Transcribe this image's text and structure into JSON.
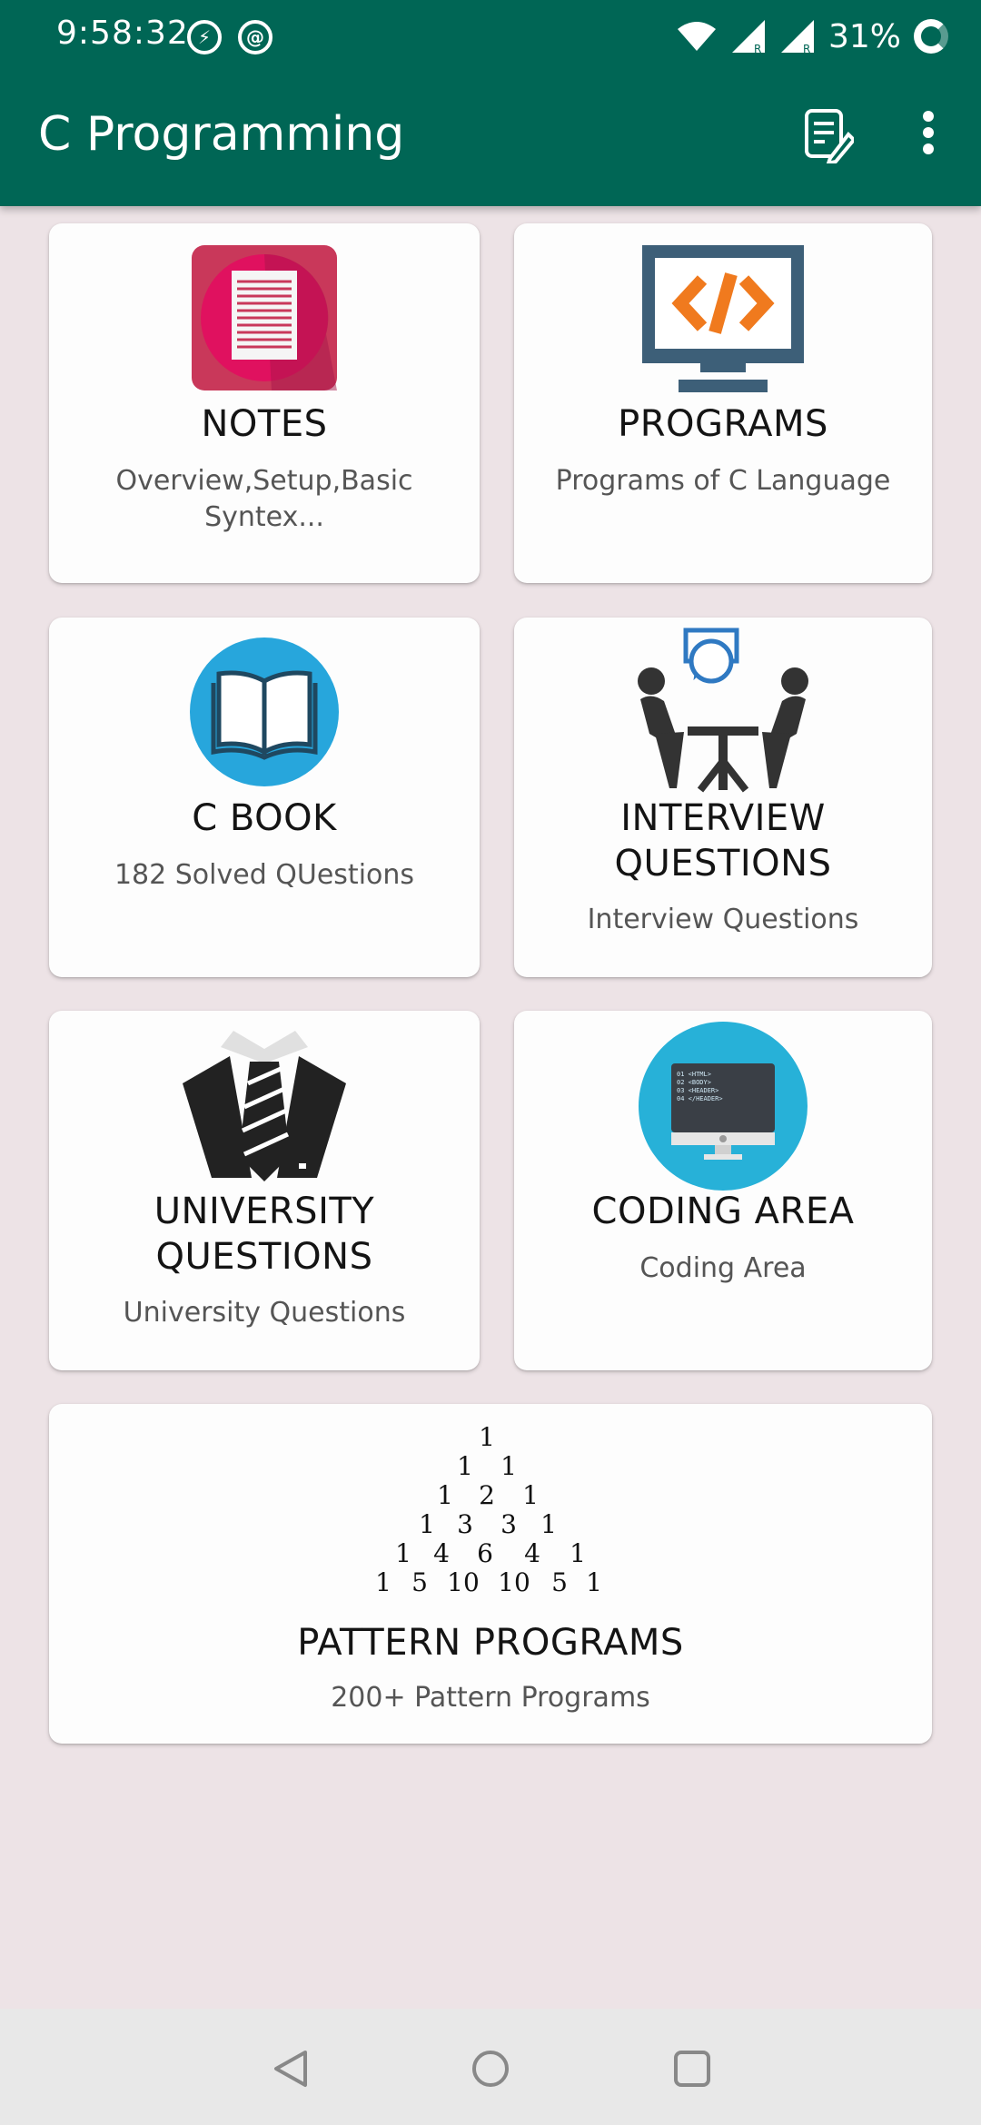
{
  "status_bar": {
    "time": "9:58:32",
    "battery_percent": "31%",
    "icons": [
      "flash-circle-icon",
      "sync-circle-icon",
      "wifi-icon",
      "signal-r-icon",
      "signal-r-icon",
      "battery-ring-icon"
    ]
  },
  "app_bar": {
    "title": "C Programming",
    "actions": [
      "notes-edit-icon",
      "more-vert-icon"
    ],
    "color": "#006655"
  },
  "cards": [
    {
      "id": "notes",
      "title": "NOTES",
      "subtitle": "Overview,Setup,Basic Syntex...",
      "icon": "notes-document-icon"
    },
    {
      "id": "programs",
      "title": "PROGRAMS",
      "subtitle": "Programs of C Language",
      "icon": "code-monitor-icon"
    },
    {
      "id": "c-book",
      "title": "C BOOK",
      "subtitle": "182 Solved QUestions",
      "icon": "open-book-icon"
    },
    {
      "id": "interview",
      "title_line1": "INTERVIEW",
      "title_line2": "QUESTIONS",
      "subtitle": "Interview Questions",
      "icon": "interview-people-icon"
    },
    {
      "id": "university",
      "title_line1": "UNIVERSITY",
      "title_line2": "QUESTIONS",
      "subtitle": "University Questions",
      "icon": "suit-tie-icon"
    },
    {
      "id": "coding-area",
      "title": "CODING AREA",
      "subtitle": "Coding Area",
      "icon": "html-monitor-icon",
      "code_lines": [
        "01 <HTML>",
        "02 <BODY>",
        "03 <HEADER>",
        "04 </HEADER>"
      ]
    },
    {
      "id": "pattern",
      "title": "PATTERN PROGRAMS",
      "subtitle": "200+ Pattern  Programs",
      "icon": "pascal-triangle-icon",
      "pattern_rows": [
        [
          "1"
        ],
        [
          "1",
          "1"
        ],
        [
          "1",
          "2",
          "1"
        ],
        [
          "1",
          "3",
          "3",
          "1"
        ],
        [
          "1",
          "4",
          "6",
          "4",
          "1"
        ],
        [
          "1",
          "5",
          "10",
          "10",
          "5",
          "1"
        ]
      ]
    }
  ],
  "nav_bar": {
    "buttons": [
      "back-icon",
      "home-icon",
      "recents-icon"
    ]
  }
}
